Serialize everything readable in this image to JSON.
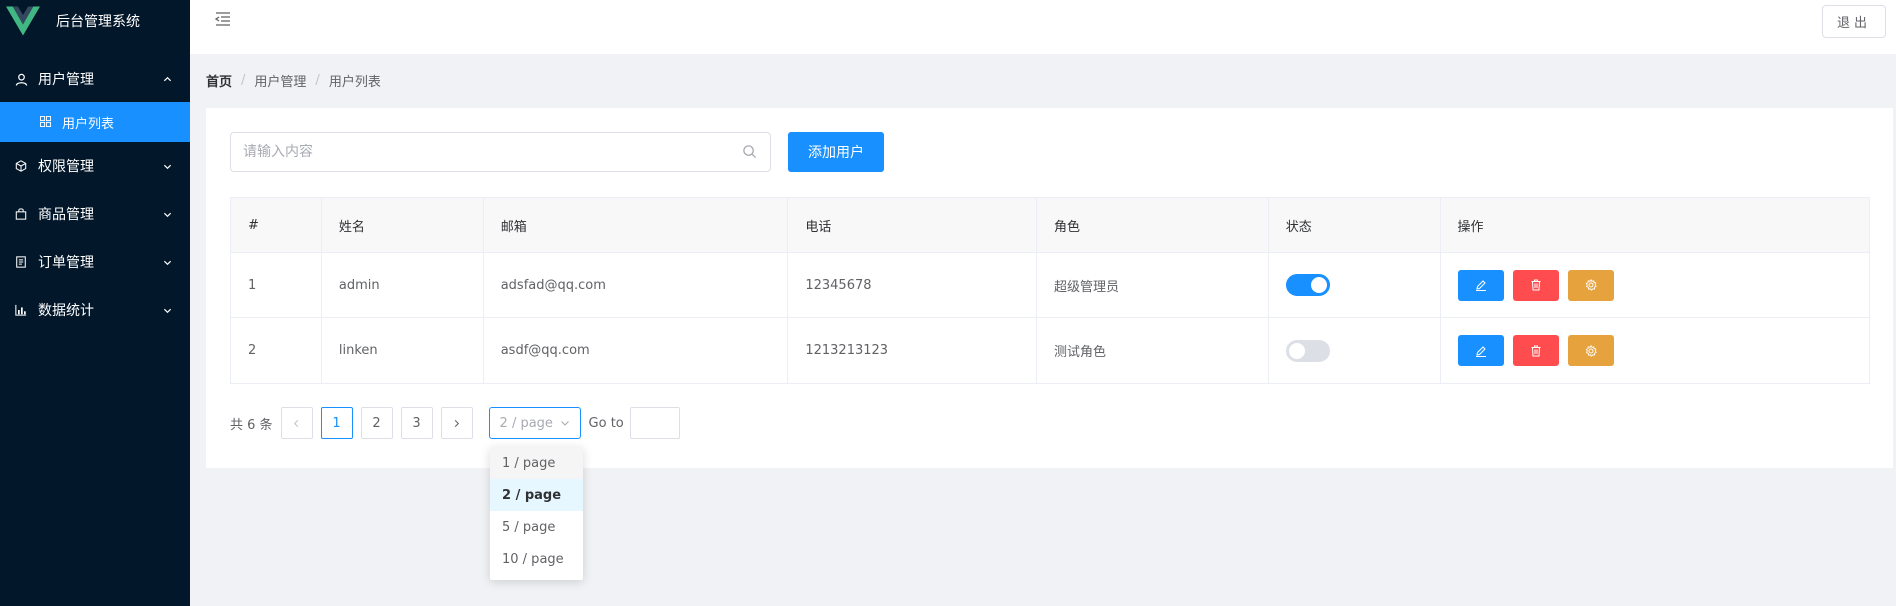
{
  "app": {
    "title": "后台管理系统",
    "logo_icon": "vue-logo-icon"
  },
  "header": {
    "logout_label": "退出"
  },
  "sidebar": {
    "items": [
      {
        "label": "用户管理",
        "icon": "user-icon",
        "expanded": true,
        "children": [
          {
            "label": "用户列表",
            "icon": "grid-icon",
            "active": true
          }
        ]
      },
      {
        "label": "权限管理",
        "icon": "cube-icon",
        "expanded": false
      },
      {
        "label": "商品管理",
        "icon": "bag-icon",
        "expanded": false
      },
      {
        "label": "订单管理",
        "icon": "document-icon",
        "expanded": false
      },
      {
        "label": "数据统计",
        "icon": "chart-icon",
        "expanded": false
      }
    ]
  },
  "breadcrumb": [
    "首页",
    "用户管理",
    "用户列表"
  ],
  "search": {
    "placeholder": "请输入内容",
    "value": ""
  },
  "add_user_label": "添加用户",
  "table": {
    "columns": [
      "#",
      "姓名",
      "邮箱",
      "电话",
      "角色",
      "状态",
      "操作"
    ],
    "rows": [
      {
        "index": "1",
        "name": "admin",
        "email": "adsfad@qq.com",
        "phone": "12345678",
        "role": "超级管理员",
        "status": true
      },
      {
        "index": "2",
        "name": "linken",
        "email": "asdf@qq.com",
        "phone": "1213213123",
        "role": "测试角色",
        "status": false
      }
    ]
  },
  "pagination": {
    "total_text": "共 6 条",
    "pages": [
      "1",
      "2",
      "3"
    ],
    "current_page": "1",
    "page_size": "2 / page",
    "goto_label": "Go to",
    "page_size_options": [
      "1 / page",
      "2 / page",
      "5 / page",
      "10 / page"
    ]
  },
  "colors": {
    "primary": "#1890ff",
    "danger": "#ff4d4f",
    "warning": "#e6a23c",
    "sidebar": "#03172a"
  }
}
